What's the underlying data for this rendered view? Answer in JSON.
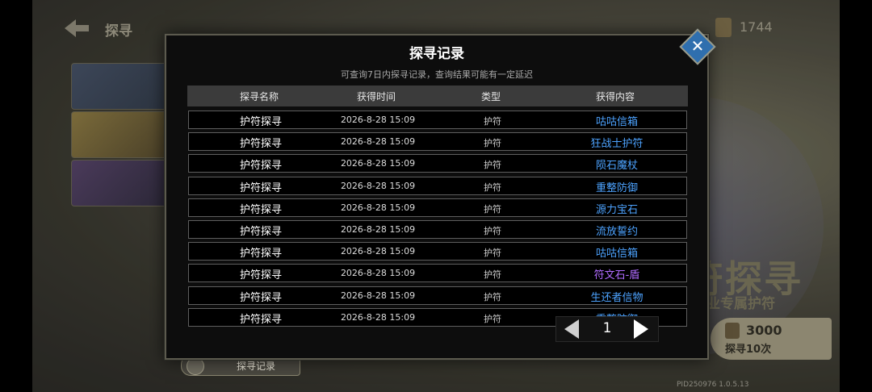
{
  "background": {
    "header_title": "探寻",
    "currency_value": "1744",
    "big_title": "符探寻",
    "sub_title": "职业专属护符",
    "draw_cost": "3000",
    "draw_label": "探寻10次",
    "bottom_tab_label": "探寻记录",
    "version_text": "PID250976  1.0.5.13"
  },
  "modal": {
    "title": "探寻记录",
    "note": "可查询7日内探寻记录，查询结果可能有一定延迟",
    "columns": [
      "探寻名称",
      "获得时间",
      "类型",
      "获得内容"
    ],
    "rows": [
      {
        "name": "护符探寻",
        "time": "2026-8-28 15:09",
        "type": "护符",
        "item": "咕咕信箱",
        "color": "#4da3ff"
      },
      {
        "name": "护符探寻",
        "time": "2026-8-28 15:09",
        "type": "护符",
        "item": "狂战士护符",
        "color": "#4da3ff"
      },
      {
        "name": "护符探寻",
        "time": "2026-8-28 15:09",
        "type": "护符",
        "item": "陨石魔杖",
        "color": "#4da3ff"
      },
      {
        "name": "护符探寻",
        "time": "2026-8-28 15:09",
        "type": "护符",
        "item": "重整防御",
        "color": "#4da3ff"
      },
      {
        "name": "护符探寻",
        "time": "2026-8-28 15:09",
        "type": "护符",
        "item": "源力宝石",
        "color": "#4da3ff"
      },
      {
        "name": "护符探寻",
        "time": "2026-8-28 15:09",
        "type": "护符",
        "item": "流放誓约",
        "color": "#4da3ff"
      },
      {
        "name": "护符探寻",
        "time": "2026-8-28 15:09",
        "type": "护符",
        "item": "咕咕信箱",
        "color": "#4da3ff"
      },
      {
        "name": "护符探寻",
        "time": "2026-8-28 15:09",
        "type": "护符",
        "item": "符文石-盾",
        "color": "#b06cff"
      },
      {
        "name": "护符探寻",
        "time": "2026-8-28 15:09",
        "type": "护符",
        "item": "生还者信物",
        "color": "#4da3ff"
      },
      {
        "name": "护符探寻",
        "time": "2026-8-28 15:09",
        "type": "护符",
        "item": "重整防御",
        "color": "#4da3ff"
      }
    ],
    "page": "1"
  }
}
